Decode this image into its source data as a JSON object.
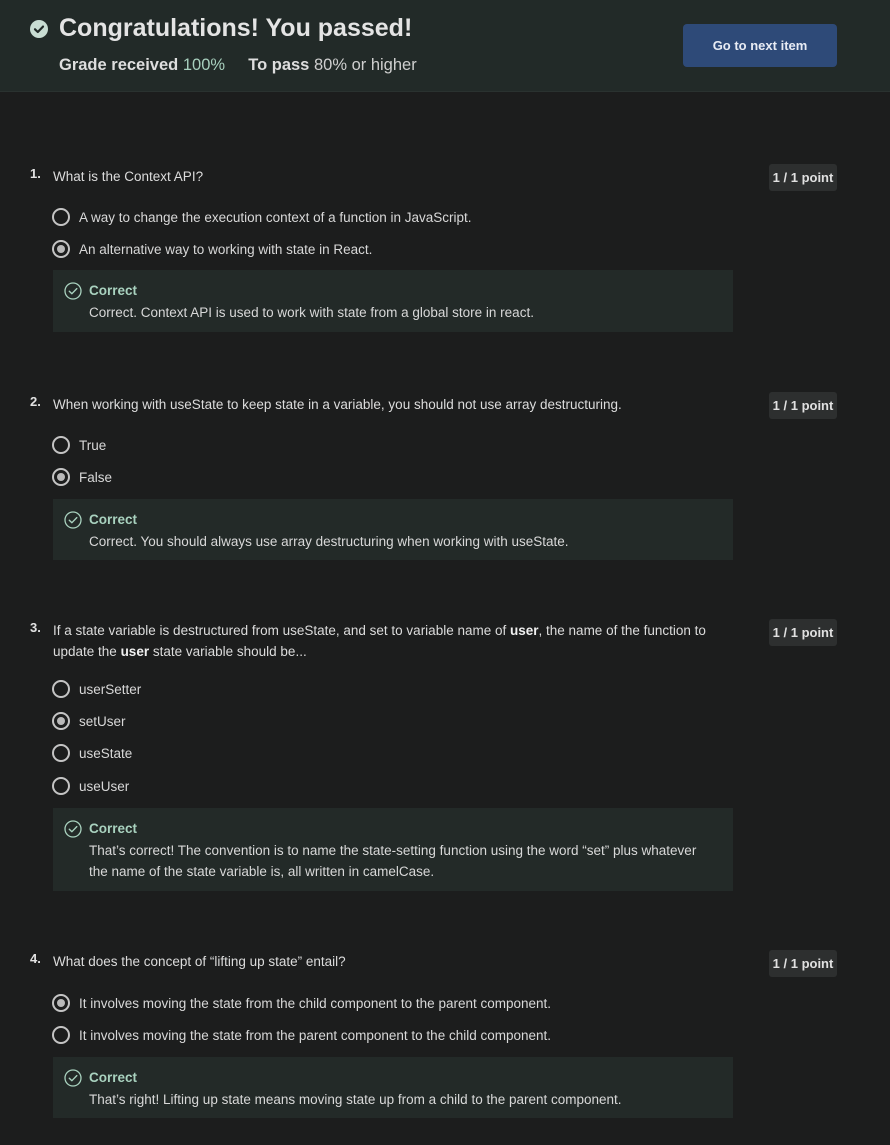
{
  "banner": {
    "title": "Congratulations! You passed!",
    "grade_label": "Grade received",
    "grade_value": "100%",
    "pass_label": "To pass",
    "pass_value": "80% or higher",
    "next_button": "Go to next item"
  },
  "questions": [
    {
      "number": "1.",
      "text_parts": [
        "What is the Context API?"
      ],
      "points": "1 / 1 point",
      "options": [
        {
          "label": "A way to change the execution context of a function in JavaScript.",
          "selected": false
        },
        {
          "label": "An alternative way to working with state in React.",
          "selected": true
        }
      ],
      "feedback": {
        "title": "Correct",
        "text": "Correct. Context API is used to work with state from a global store in react."
      }
    },
    {
      "number": "2.",
      "text_parts": [
        "When working with useState to keep state in a variable, you should not use array destructuring."
      ],
      "points": "1 / 1 point",
      "options": [
        {
          "label": "True",
          "selected": false
        },
        {
          "label": "False",
          "selected": true
        }
      ],
      "feedback": {
        "title": "Correct",
        "text": "Correct. You should always use array destructuring when working with useState."
      }
    },
    {
      "number": "3.",
      "text_parts": [
        "If a state variable is destructured from useState, and set to variable name of ",
        "user",
        ", the name of the function to update the ",
        "user",
        " state variable should be..."
      ],
      "points": "1 / 1 point",
      "options": [
        {
          "label": "userSetter",
          "selected": false
        },
        {
          "label": "setUser",
          "selected": true
        },
        {
          "label": "useState",
          "selected": false
        },
        {
          "label": "useUser",
          "selected": false
        }
      ],
      "feedback": {
        "title": "Correct",
        "text": "That’s correct! The convention is to name the state-setting function using the word “set” plus whatever the name of the state variable is, all written in camelCase."
      }
    },
    {
      "number": "4.",
      "text_parts": [
        "What does the concept of “lifting up state” entail?"
      ],
      "points": "1 / 1 point",
      "options": [
        {
          "label": "It involves moving the state from the child component to the parent component.",
          "selected": true
        },
        {
          "label": "It involves moving the state from the parent component to the child component.",
          "selected": false
        }
      ],
      "feedback": {
        "title": "Correct",
        "text": "That’s right! Lifting up state means moving state up from a child to the parent component."
      }
    }
  ]
}
